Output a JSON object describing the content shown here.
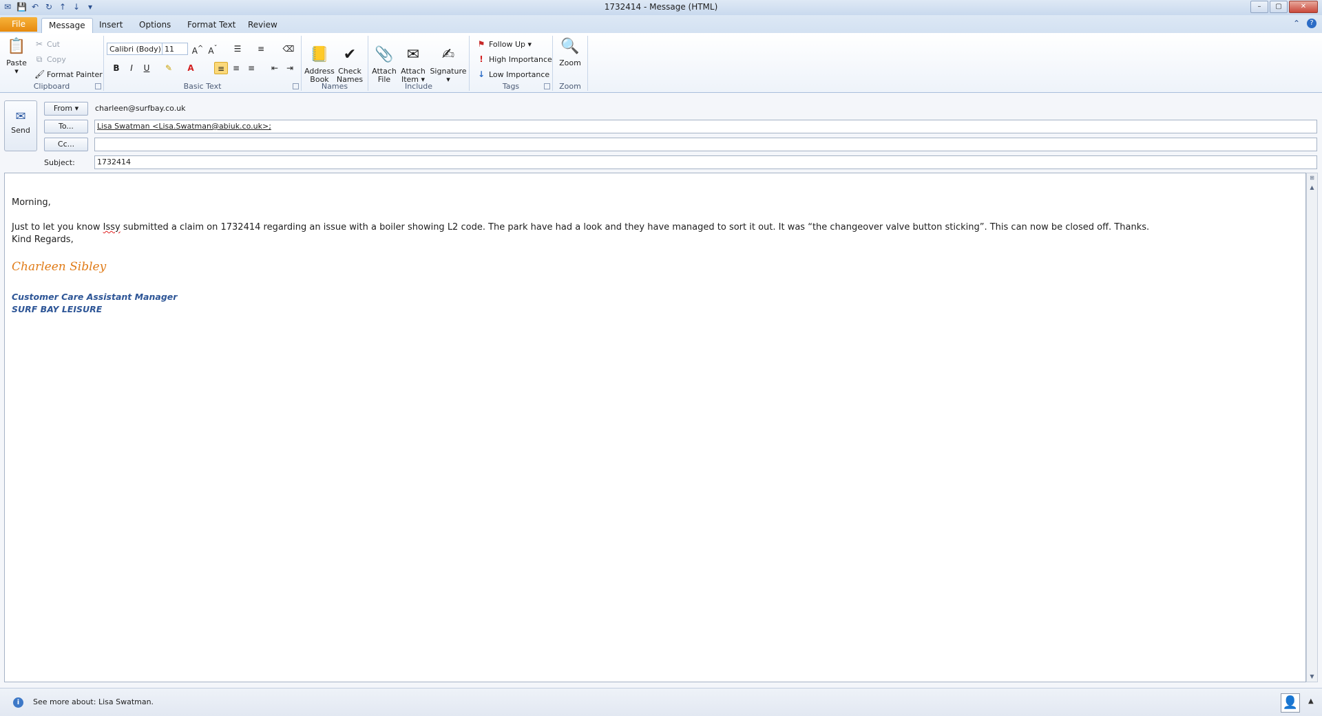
{
  "window": {
    "title": "1732414  -  Message (HTML)",
    "controls": [
      "–",
      "▢",
      "✕"
    ]
  },
  "tabs": [
    {
      "label": "File"
    },
    {
      "label": "Message"
    },
    {
      "label": "Insert"
    },
    {
      "label": "Options"
    },
    {
      "label": "Format Text"
    },
    {
      "label": "Review"
    }
  ],
  "ribbon": {
    "clipboard": {
      "label": "Clipboard",
      "paste": "Paste",
      "cut": "Cut",
      "copy": "Copy",
      "format_painter": "Format Painter"
    },
    "basic_text": {
      "label": "Basic Text",
      "font": "Calibri (Body)",
      "size": "11",
      "bold": "B",
      "italic": "I",
      "underline": "U"
    },
    "names": {
      "label": "Names",
      "address_book": "Address\nBook",
      "check_names": "Check\nNames"
    },
    "include": {
      "label": "Include",
      "attach_file": "Attach\nFile",
      "attach_item": "Attach\nItem ▾",
      "signature": "Signature\n▾"
    },
    "tags": {
      "label": "Tags",
      "follow_up": "Follow Up ▾",
      "high_importance": "High Importance",
      "low_importance": "Low Importance"
    },
    "zoom": {
      "label": "Zoom",
      "zoom": "Zoom"
    }
  },
  "header": {
    "send": "Send",
    "from_label": "From ▾",
    "from_value": "charleen@surfbay.co.uk",
    "to_label": "To...",
    "to_value": "Lisa Swatman <Lisa.Swatman@abiuk.co.uk>;",
    "cc_label": "Cc...",
    "cc_value": "",
    "subject_label": "Subject:",
    "subject_value": "1732414"
  },
  "body": {
    "greeting": "Morning,",
    "para_before": "Just to let you know ",
    "para_misspelled": "Issy",
    "para_after": " submitted a claim on 1732414 regarding an issue with a boiler showing L2 code. The park have had a look and they have managed to sort it out.  It was “the changeover valve button sticking”.  This can now be closed off.  Thanks.",
    "closing": "Kind Regards,",
    "signature_name": "Charleen Sibley",
    "signature_title": "Customer Care Assistant Manager",
    "signature_company": "SURF BAY LEISURE"
  },
  "status": {
    "text": "See more about: Lisa Swatman."
  }
}
